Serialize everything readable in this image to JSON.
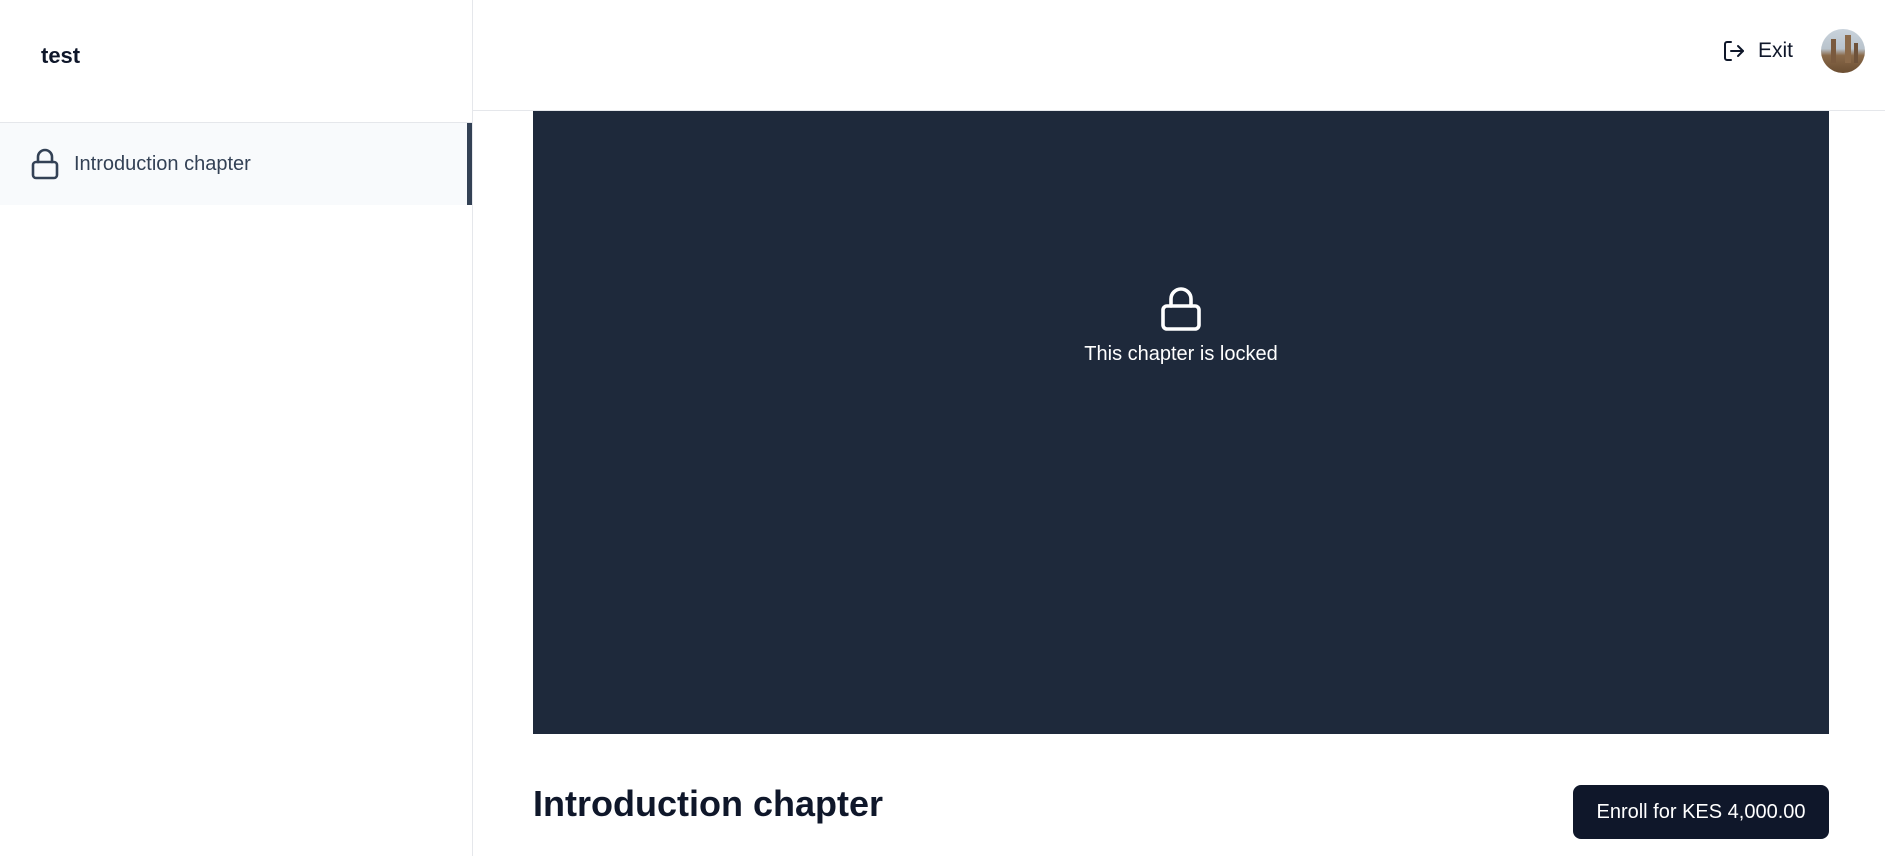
{
  "sidebar": {
    "course_title": "test",
    "chapters": [
      {
        "label": "Introduction chapter",
        "icon": "lock-icon",
        "active": true
      }
    ]
  },
  "topbar": {
    "exit_label": "Exit",
    "exit_icon": "log-out-icon",
    "avatar": "user-avatar"
  },
  "player": {
    "locked_message": "This chapter is locked",
    "background_color": "#1e293b",
    "icon": "lock-icon"
  },
  "chapter": {
    "title": "Introduction chapter",
    "enroll_label": "Enroll for KES 4,000.00"
  },
  "colors": {
    "primary": "#0f172a",
    "active_indicator": "#334155",
    "active_bg": "#f8fafc"
  }
}
